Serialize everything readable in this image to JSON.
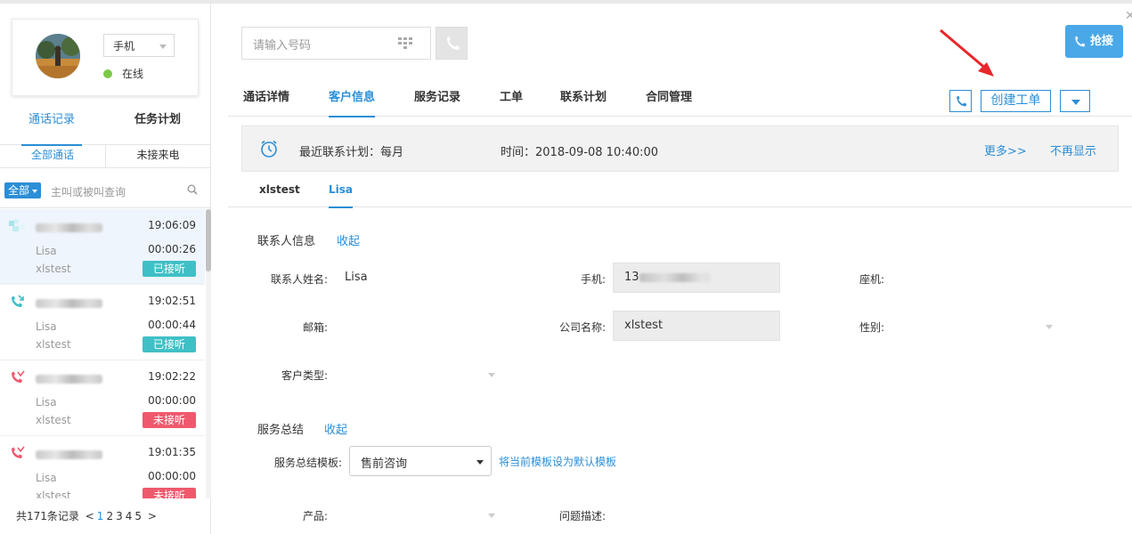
{
  "agent": {
    "device_label": "手机",
    "status_text": "在线",
    "status_color": "#7cc94a"
  },
  "left_tabs": [
    {
      "label": "通话记录",
      "active": true
    },
    {
      "label": "任务计划",
      "active": false
    }
  ],
  "sub_tabs": [
    {
      "label": "全部通话",
      "active": true
    },
    {
      "label": "未接来电",
      "active": false
    }
  ],
  "search": {
    "filter_label": "全部",
    "placeholder": "主叫或被叫查询"
  },
  "calls": [
    {
      "icon": "incoming-call-icon",
      "time": "19:06:09",
      "name": "Lisa",
      "duration": "00:00:26",
      "company": "xlstest",
      "status": "已接听",
      "status_type": "ok",
      "selected": true
    },
    {
      "icon": "incoming-call-icon",
      "time": "19:02:51",
      "name": "Lisa",
      "duration": "00:00:44",
      "company": "xlstest",
      "status": "已接听",
      "status_type": "ok",
      "selected": false
    },
    {
      "icon": "missed-call-icon",
      "time": "19:02:22",
      "name": "Lisa",
      "duration": "00:00:00",
      "company": "xlstest",
      "status": "未接听",
      "status_type": "miss",
      "selected": false
    },
    {
      "icon": "missed-call-icon",
      "time": "19:01:35",
      "name": "Lisa",
      "duration": "00:00:00",
      "company": "xlstest",
      "status": "未接听",
      "status_type": "miss",
      "selected": false
    }
  ],
  "pager": {
    "total_text": "共171条记录",
    "prev": "<",
    "pages": [
      "1",
      "2",
      "3",
      "4",
      "5"
    ],
    "current_page": "1",
    "next": ">"
  },
  "dialer": {
    "placeholder": "请输入号码"
  },
  "grab_button": "抢接",
  "main_tabs": [
    {
      "label": "通话详情",
      "active": false
    },
    {
      "label": "客户信息",
      "active": true
    },
    {
      "label": "服务记录",
      "active": false
    },
    {
      "label": "工单",
      "active": false
    },
    {
      "label": "联系计划",
      "active": false
    },
    {
      "label": "合同管理",
      "active": false
    }
  ],
  "toolbar": {
    "create_ticket_label": "创建工单"
  },
  "notice": {
    "plan_text": "最近联系计划：每月",
    "time_text": "时间：2018-09-08 10:40:00",
    "more_link": "更多>>",
    "hide_link": "不再显示"
  },
  "contact_tabs": [
    {
      "label": "xlstest",
      "active": false
    },
    {
      "label": "Lisa",
      "active": true
    }
  ],
  "contact_section": {
    "title": "联系人信息",
    "toggle": "收起",
    "fields": {
      "name_label": "联系人姓名:",
      "name_value": "Lisa",
      "mobile_label": "手机:",
      "mobile_prefix": "13",
      "landline_label": "座机:",
      "email_label": "邮箱:",
      "company_label": "公司名称:",
      "company_value": "xlstest",
      "gender_label": "性别:",
      "customer_type_label": "客户类型:"
    }
  },
  "service_section": {
    "title": "服务总结",
    "toggle": "收起",
    "template_label": "服务总结模板:",
    "template_value": "售前咨询",
    "set_default_link": "将当前模板设为默认模板",
    "product_label": "产品:",
    "issue_label": "问题描述:"
  },
  "colors": {
    "accent": "#2b8ed6",
    "answered": "#3fc0c6",
    "missed": "#f0596d",
    "grab_button": "#4aa8e8",
    "annotation_arrow": "#e8262b"
  }
}
